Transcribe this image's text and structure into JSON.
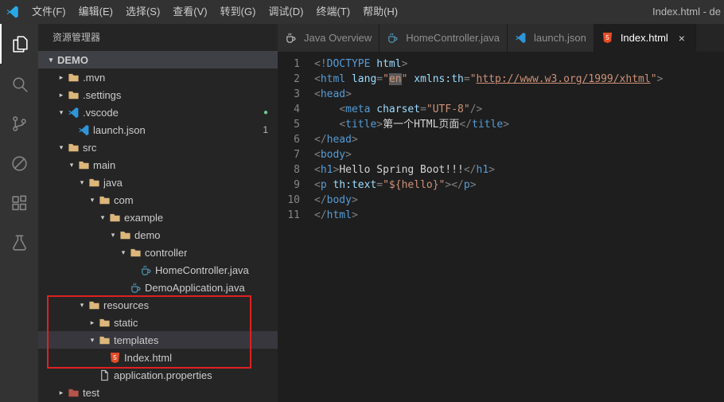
{
  "window": {
    "title": "Index.html - de"
  },
  "menu_bar": {
    "items": [
      "文件(F)",
      "编辑(E)",
      "选择(S)",
      "查看(V)",
      "转到(G)",
      "调试(D)",
      "终端(T)",
      "帮助(H)"
    ]
  },
  "activity_bar": {
    "items": [
      {
        "name": "explorer",
        "active": true
      },
      {
        "name": "search",
        "active": false
      },
      {
        "name": "source-control",
        "active": false
      },
      {
        "name": "blocked",
        "active": false
      },
      {
        "name": "extensions",
        "active": false
      },
      {
        "name": "tests",
        "active": false
      }
    ]
  },
  "sidebar": {
    "title": "资源管理器",
    "tree": [
      {
        "label": "DEMO",
        "depth": 0,
        "arrow": "down",
        "icon": null,
        "root": true
      },
      {
        "label": ".mvn",
        "depth": 1,
        "arrow": "right",
        "icon": "folder"
      },
      {
        "label": ".settings",
        "depth": 1,
        "arrow": "right",
        "icon": "folder"
      },
      {
        "label": ".vscode",
        "depth": 1,
        "arrow": "down",
        "icon": "vscode",
        "dot": "●"
      },
      {
        "label": "launch.json",
        "depth": 2,
        "arrow": null,
        "icon": "vscode",
        "badge": "1"
      },
      {
        "label": "src",
        "depth": 1,
        "arrow": "down",
        "icon": "folder"
      },
      {
        "label": "main",
        "depth": 2,
        "arrow": "down",
        "icon": "folder"
      },
      {
        "label": "java",
        "depth": 3,
        "arrow": "down",
        "icon": "folder"
      },
      {
        "label": "com",
        "depth": 4,
        "arrow": "down",
        "icon": "folder"
      },
      {
        "label": "example",
        "depth": 5,
        "arrow": "down",
        "icon": "folder"
      },
      {
        "label": "demo",
        "depth": 6,
        "arrow": "down",
        "icon": "folder"
      },
      {
        "label": "controller",
        "depth": 7,
        "arrow": "down",
        "icon": "folder"
      },
      {
        "label": "HomeController.java",
        "depth": 8,
        "arrow": null,
        "icon": "java"
      },
      {
        "label": "DemoApplication.java",
        "depth": 7,
        "arrow": null,
        "icon": "java"
      },
      {
        "label": "resources",
        "depth": 3,
        "arrow": "down",
        "icon": "folder"
      },
      {
        "label": "static",
        "depth": 4,
        "arrow": "right",
        "icon": "folder"
      },
      {
        "label": "templates",
        "depth": 4,
        "arrow": "down",
        "icon": "folder",
        "selected": true
      },
      {
        "label": "Index.html",
        "depth": 5,
        "arrow": null,
        "icon": "html"
      },
      {
        "label": "application.properties",
        "depth": 4,
        "arrow": null,
        "icon": "file"
      },
      {
        "label": "test",
        "depth": 1,
        "arrow": "right",
        "icon": "folder-red"
      }
    ]
  },
  "tabs": [
    {
      "label": "Java Overview",
      "icon": "java-gray",
      "active": false
    },
    {
      "label": "HomeController.java",
      "icon": "java",
      "active": false
    },
    {
      "label": "launch.json",
      "icon": "vscode",
      "active": false
    },
    {
      "label": "Index.html",
      "icon": "html",
      "active": true,
      "close": "×"
    }
  ],
  "editor": {
    "lines": [
      {
        "n": "1",
        "segs": [
          [
            "p",
            "<!"
          ],
          [
            "t",
            "DOCTYPE"
          ],
          [
            "a",
            " html"
          ],
          [
            "p",
            ">"
          ]
        ]
      },
      {
        "n": "2",
        "segs": [
          [
            "p",
            "<"
          ],
          [
            "t",
            "html"
          ],
          [
            "x",
            " "
          ],
          [
            "a",
            "lang"
          ],
          [
            "p",
            "="
          ],
          [
            "s",
            "\""
          ],
          [
            "shl",
            "en"
          ],
          [
            "s",
            "\""
          ],
          [
            "x",
            " "
          ],
          [
            "a",
            "xmlns:th"
          ],
          [
            "p",
            "="
          ],
          [
            "s",
            "\""
          ],
          [
            "link",
            "http://www.w3.org/1999/xhtml"
          ],
          [
            "s",
            "\""
          ],
          [
            "p",
            ">"
          ]
        ]
      },
      {
        "n": "3",
        "segs": [
          [
            "p",
            "<"
          ],
          [
            "t",
            "head"
          ],
          [
            "p",
            ">"
          ]
        ]
      },
      {
        "n": "4",
        "segs": [
          [
            "x",
            "    "
          ],
          [
            "p",
            "<"
          ],
          [
            "t",
            "meta"
          ],
          [
            "x",
            " "
          ],
          [
            "a",
            "charset"
          ],
          [
            "p",
            "="
          ],
          [
            "s",
            "\"UTF-8\""
          ],
          [
            "p",
            "/>"
          ]
        ]
      },
      {
        "n": "5",
        "segs": [
          [
            "x",
            "    "
          ],
          [
            "p",
            "<"
          ],
          [
            "t",
            "title"
          ],
          [
            "p",
            ">"
          ],
          [
            "x",
            "第一个HTML页面"
          ],
          [
            "p",
            "</"
          ],
          [
            "t",
            "title"
          ],
          [
            "p",
            ">"
          ]
        ]
      },
      {
        "n": "6",
        "segs": [
          [
            "p",
            "</"
          ],
          [
            "t",
            "head"
          ],
          [
            "p",
            ">"
          ]
        ]
      },
      {
        "n": "7",
        "segs": [
          [
            "p",
            "<"
          ],
          [
            "t",
            "body"
          ],
          [
            "p",
            ">"
          ]
        ]
      },
      {
        "n": "8",
        "segs": [
          [
            "p",
            "<"
          ],
          [
            "t",
            "h1"
          ],
          [
            "p",
            ">"
          ],
          [
            "x",
            "Hello Spring Boot!!!"
          ],
          [
            "p",
            "</"
          ],
          [
            "t",
            "h1"
          ],
          [
            "p",
            ">"
          ]
        ]
      },
      {
        "n": "9",
        "segs": [
          [
            "p",
            "<"
          ],
          [
            "t",
            "p"
          ],
          [
            "x",
            " "
          ],
          [
            "a",
            "th:text"
          ],
          [
            "p",
            "="
          ],
          [
            "s",
            "\"${hello}\""
          ],
          [
            "p",
            ">"
          ],
          [
            "p",
            "</"
          ],
          [
            "t",
            "p"
          ],
          [
            "p",
            ">"
          ]
        ]
      },
      {
        "n": "10",
        "segs": [
          [
            "p",
            "</"
          ],
          [
            "t",
            "body"
          ],
          [
            "p",
            ">"
          ]
        ]
      },
      {
        "n": "11",
        "segs": [
          [
            "p",
            "</"
          ],
          [
            "t",
            "html"
          ],
          [
            "p",
            ">"
          ]
        ]
      }
    ]
  },
  "annotation": {
    "color": "#e02020"
  }
}
